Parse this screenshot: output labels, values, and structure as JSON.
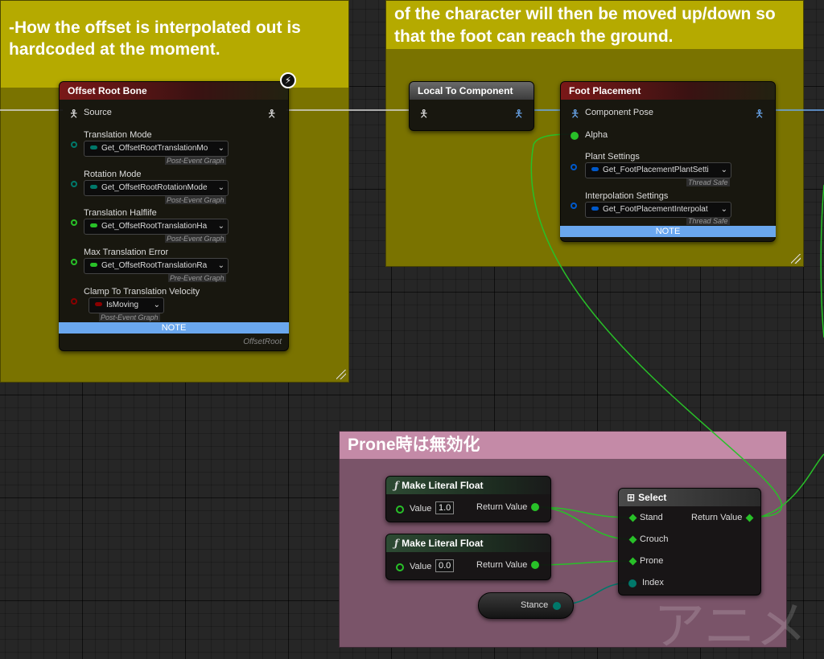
{
  "comments": {
    "left_text": "-How the offset is interpolated out is hardcoded at the moment.",
    "right_line1": "of the character will then be moved up/down so",
    "right_line2": "that the foot can reach the ground.",
    "prone_title": "Prone時は無効化",
    "watermark": "アニメ"
  },
  "offset_root": {
    "title": "Offset Root Bone",
    "source": "Source",
    "translation_mode": {
      "label": "Translation Mode",
      "value": "Get_OffsetRootTranslationMo",
      "sub": "Post-Event Graph"
    },
    "rotation_mode": {
      "label": "Rotation Mode",
      "value": "Get_OffsetRootRotationMode",
      "sub": "Post-Event Graph"
    },
    "translation_halflife": {
      "label": "Translation Halflife",
      "value": "Get_OffsetRootTranslationHa",
      "sub": "Post-Event Graph"
    },
    "max_translation_error": {
      "label": "Max Translation Error",
      "value": "Get_OffsetRootTranslationRa",
      "sub": "Pre-Event Graph"
    },
    "clamp_velocity": {
      "label": "Clamp To Translation Velocity",
      "value": "IsMoving",
      "sub": "Post-Event Graph"
    },
    "note": "NOTE",
    "footer": "OffsetRoot"
  },
  "local_to_component": {
    "title": "Local To Component"
  },
  "foot_placement": {
    "title": "Foot Placement",
    "component_pose": "Component Pose",
    "alpha": "Alpha",
    "plant_settings": {
      "label": "Plant Settings",
      "value": "Get_FootPlacementPlantSetti",
      "sub": "Thread Safe"
    },
    "interpolation_settings": {
      "label": "Interpolation Settings",
      "value": "Get_FootPlacementInterpolat",
      "sub": "Thread Safe"
    },
    "note": "NOTE"
  },
  "literal1": {
    "title": "Make Literal Float",
    "value_label": "Value",
    "value": "1.0",
    "return": "Return Value"
  },
  "literal2": {
    "title": "Make Literal Float",
    "value_label": "Value",
    "value": "0.0",
    "return": "Return Value"
  },
  "select": {
    "title": "Select",
    "stand": "Stand",
    "crouch": "Crouch",
    "prone": "Prone",
    "index": "Index",
    "return": "Return Value"
  },
  "stance": {
    "label": "Stance"
  },
  "colors": {
    "exec_blue": "#6aa7ee",
    "float_green": "#28c028",
    "bool_red": "#8a0000",
    "enum_teal": "#00786a",
    "struct_blue": "#0059cb"
  }
}
